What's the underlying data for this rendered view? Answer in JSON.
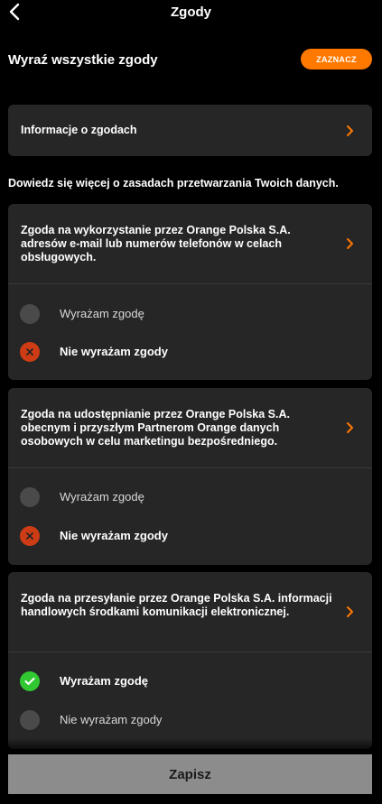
{
  "header": {
    "title": "Zgody"
  },
  "all_consents": {
    "label": "Wyraź wszystkie zgody",
    "button": "ZAZNACZ"
  },
  "info_card": {
    "label": "Informacje o zgodach"
  },
  "info_text": "Dowiedz się więcej o zasadach przetwarzania Twoich danych.",
  "consents": [
    {
      "text": "Zgoda na wykorzystanie przez Orange Polska S.A. adresów e-mail lub numerów telefonów w celach obsługowych.",
      "options": [
        {
          "label": "Wyrażam zgodę",
          "state": "unselected"
        },
        {
          "label": "Nie wyrażam zgody",
          "state": "selected-no"
        }
      ]
    },
    {
      "text": "Zgoda na udostępnianie przez Orange Polska S.A. obecnym i przyszłym Partnerom Orange danych osobowych w celu marketingu bezpośredniego.",
      "options": [
        {
          "label": "Wyrażam zgodę",
          "state": "unselected"
        },
        {
          "label": "Nie wyrażam zgody",
          "state": "selected-no"
        }
      ]
    },
    {
      "text": "Zgoda na przesyłanie przez Orange Polska S.A. informacji handlowych środkami komunikacji elektronicznej.",
      "options": [
        {
          "label": "Wyrażam zgodę",
          "state": "selected-yes"
        },
        {
          "label": "Nie wyrażam zgody",
          "state": "unselected"
        }
      ]
    }
  ],
  "save_button": "Zapisz",
  "colors": {
    "accent": "#ff7900",
    "card": "#262626",
    "no": "#cd3c14",
    "yes": "#32c832",
    "radio_off": "#4a4a4a",
    "save_disabled": "#8c8c8c"
  }
}
